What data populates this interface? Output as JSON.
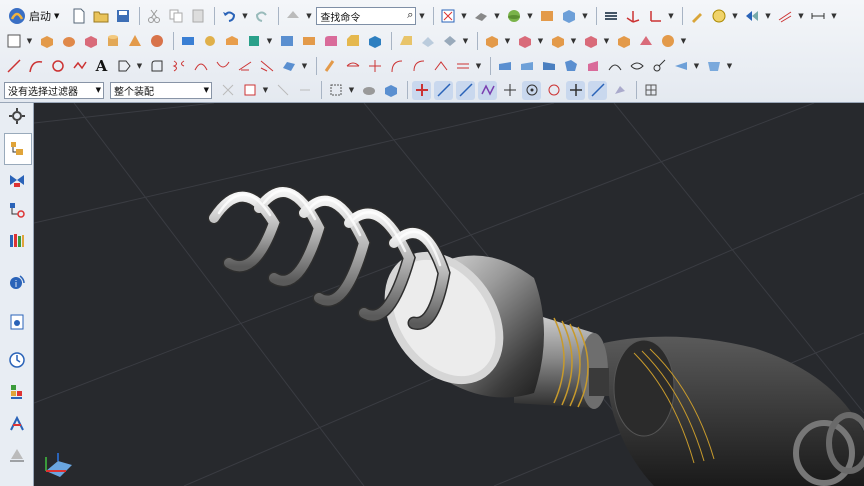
{
  "toolbar": {
    "start_label": "启动",
    "search_placeholder": "查找命令",
    "selection_filter": "没有选择过滤器",
    "assembly_scope": "整个装配"
  },
  "icons": {
    "row1": [
      "app-logo-icon",
      "new-file-icon",
      "open-folder-icon",
      "save-icon",
      "cut-icon",
      "copy-icon",
      "paste-icon",
      "undo-icon",
      "redo-icon",
      "repeat-command-icon",
      "fit-view-icon",
      "shaded-view-icon",
      "sphere-render-icon",
      "background-icon",
      "view-orient-icon",
      "layer-icon",
      "wcs-icon",
      "csys-icon",
      "edit-object-icon",
      "measure-icon",
      "snap-view-icon",
      "grid-icon",
      "dimension-icon"
    ],
    "row2": [
      "sketch-icon",
      "extrude-icon",
      "revolve-icon",
      "block-icon",
      "cylinder-icon",
      "cone-icon",
      "sphere-icon",
      "hole-icon",
      "boss-icon",
      "pocket-icon",
      "pad-icon",
      "slot-icon",
      "groove-icon",
      "blend-icon",
      "chamfer-icon",
      "shell-icon",
      "draft-icon",
      "trim-icon",
      "split-icon",
      "pattern-icon",
      "mirror-icon",
      "sew-icon",
      "offset-icon"
    ],
    "row3": [
      "line-icon",
      "arc-icon",
      "circle-icon",
      "point-icon",
      "text-icon",
      "spline-icon",
      "fillet-curve-icon",
      "helix-icon",
      "bridge-curve-icon",
      "project-curve-icon",
      "intersect-curve-icon",
      "offset-curve-icon",
      "mesh-surface-icon",
      "swept-icon",
      "through-curves-icon"
    ]
  },
  "colors": {
    "viewport_bg": "#27292d",
    "toolbar_bg": "#e8edf3",
    "accent": "#3a6fc4",
    "thread_gold": "#c79a2c"
  }
}
